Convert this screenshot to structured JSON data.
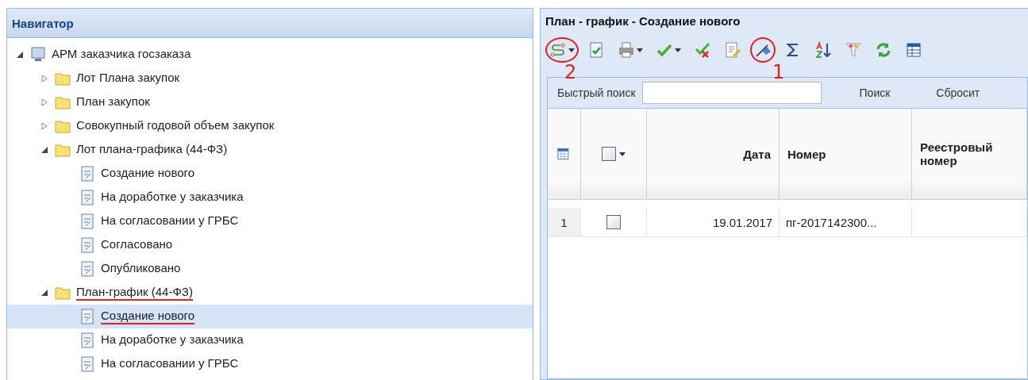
{
  "navigator": {
    "title": "Навигатор",
    "tree": [
      {
        "kind": "root",
        "label": "АРМ заказчика госзаказа",
        "expanded": true,
        "selected": false,
        "underlined": false,
        "children": [
          {
            "kind": "folder",
            "label": "Лот Плана закупок",
            "expanded": false,
            "selected": false,
            "underlined": false
          },
          {
            "kind": "folder",
            "label": "План закупок",
            "expanded": false,
            "selected": false,
            "underlined": false
          },
          {
            "kind": "folder",
            "label": "Совокупный годовой объем закупок",
            "expanded": false,
            "selected": false,
            "underlined": false
          },
          {
            "kind": "folder",
            "label": "Лот плана-графика (44-ФЗ)",
            "expanded": true,
            "selected": false,
            "underlined": false,
            "children": [
              {
                "kind": "leaf",
                "label": "Создание нового",
                "selected": false,
                "underlined": false
              },
              {
                "kind": "leaf",
                "label": "На доработке у заказчика",
                "selected": false,
                "underlined": false
              },
              {
                "kind": "leaf",
                "label": "На согласовании у ГРБС",
                "selected": false,
                "underlined": false
              },
              {
                "kind": "leaf",
                "label": "Согласовано",
                "selected": false,
                "underlined": false
              },
              {
                "kind": "leaf",
                "label": "Опубликовано",
                "selected": false,
                "underlined": false
              }
            ]
          },
          {
            "kind": "folder",
            "label": "План-график (44-ФЗ)",
            "expanded": true,
            "selected": false,
            "underlined": true,
            "children": [
              {
                "kind": "leaf",
                "label": "Создание нового",
                "selected": true,
                "underlined": true
              },
              {
                "kind": "leaf",
                "label": "На доработке у заказчика",
                "selected": false,
                "underlined": false
              },
              {
                "kind": "leaf",
                "label": "На согласовании у ГРБС",
                "selected": false,
                "underlined": false
              }
            ]
          }
        ]
      }
    ]
  },
  "panel": {
    "title": "План - график - Создание нового",
    "toolbar": [
      {
        "dropdown": true,
        "circled": true,
        "note": "2"
      },
      {
        "dropdown": false,
        "circled": false
      },
      {
        "dropdown": true,
        "circled": false
      },
      {
        "dropdown": true,
        "circled": false
      },
      {
        "dropdown": false,
        "circled": false
      },
      {
        "dropdown": false,
        "circled": false
      },
      {
        "dropdown": false,
        "circled": true,
        "note": "1"
      },
      {
        "dropdown": false,
        "circled": false
      },
      {
        "dropdown": false,
        "circled": false
      },
      {
        "dropdown": false,
        "circled": false
      },
      {
        "dropdown": false,
        "circled": false
      },
      {
        "dropdown": false,
        "circled": false
      }
    ],
    "search": {
      "label": "Быстрый поиск",
      "find_button": "Поиск",
      "reset_button": "Сбросит"
    },
    "grid": {
      "header_checked": false,
      "columns": [
        "Дата",
        "Номер",
        "Реестровый номер"
      ],
      "rows": [
        {
          "number": "1",
          "checked": false,
          "cells": [
            "19.01.2017",
            "пг-2017142300...",
            ""
          ]
        }
      ]
    }
  }
}
